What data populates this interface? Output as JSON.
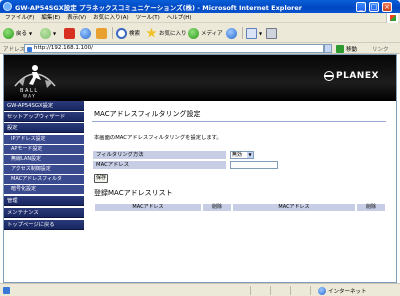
{
  "window": {
    "title": "GW-AP54SGX設定 プラネックスコミュニケーションズ(株) - Microsoft Internet Explorer"
  },
  "menu": [
    "ファイル(F)",
    "編集(E)",
    "表示(V)",
    "お気に入り(A)",
    "ツール(T)",
    "ヘルプ(H)"
  ],
  "toolbar": {
    "back": "戻る",
    "search": "検索",
    "favorites": "お気に入り",
    "media": "メディア"
  },
  "address": {
    "label": "アドレス(D)",
    "url": "http://192.168.1.100/",
    "go": "移動",
    "links": "リンク"
  },
  "brand": {
    "planex": "PLANEX"
  },
  "sidebar": {
    "items": [
      {
        "label": "GW-AP54SGX設定"
      },
      {
        "label": "セットアップウィザード"
      },
      {
        "label": "設定"
      },
      {
        "label": "IPアドレス設定"
      },
      {
        "label": "APモード設定"
      },
      {
        "label": "無線LAN設定"
      },
      {
        "label": "アクセス制御設定"
      },
      {
        "label": "MACアドレスフィルタ"
      },
      {
        "label": "暗号化設定"
      },
      {
        "label": "管理"
      },
      {
        "label": "メンテナンス"
      },
      {
        "label": "トップページに戻る"
      }
    ]
  },
  "main": {
    "title": "MACアドレスフィルタリング設定",
    "description": "本画面のMACアドレスフィルタリングを設定します。",
    "form": {
      "filter_label": "フィルタリング方法",
      "filter_value": "無効",
      "mac_label": "MACアドレス",
      "mac_value": ""
    },
    "save_label": "保存",
    "list_title": "登録MACアドレスリスト",
    "table_headers": [
      "MACアドレス",
      "削除",
      "MACアドレス",
      "削除"
    ]
  },
  "status": {
    "zone": "インターネット"
  }
}
